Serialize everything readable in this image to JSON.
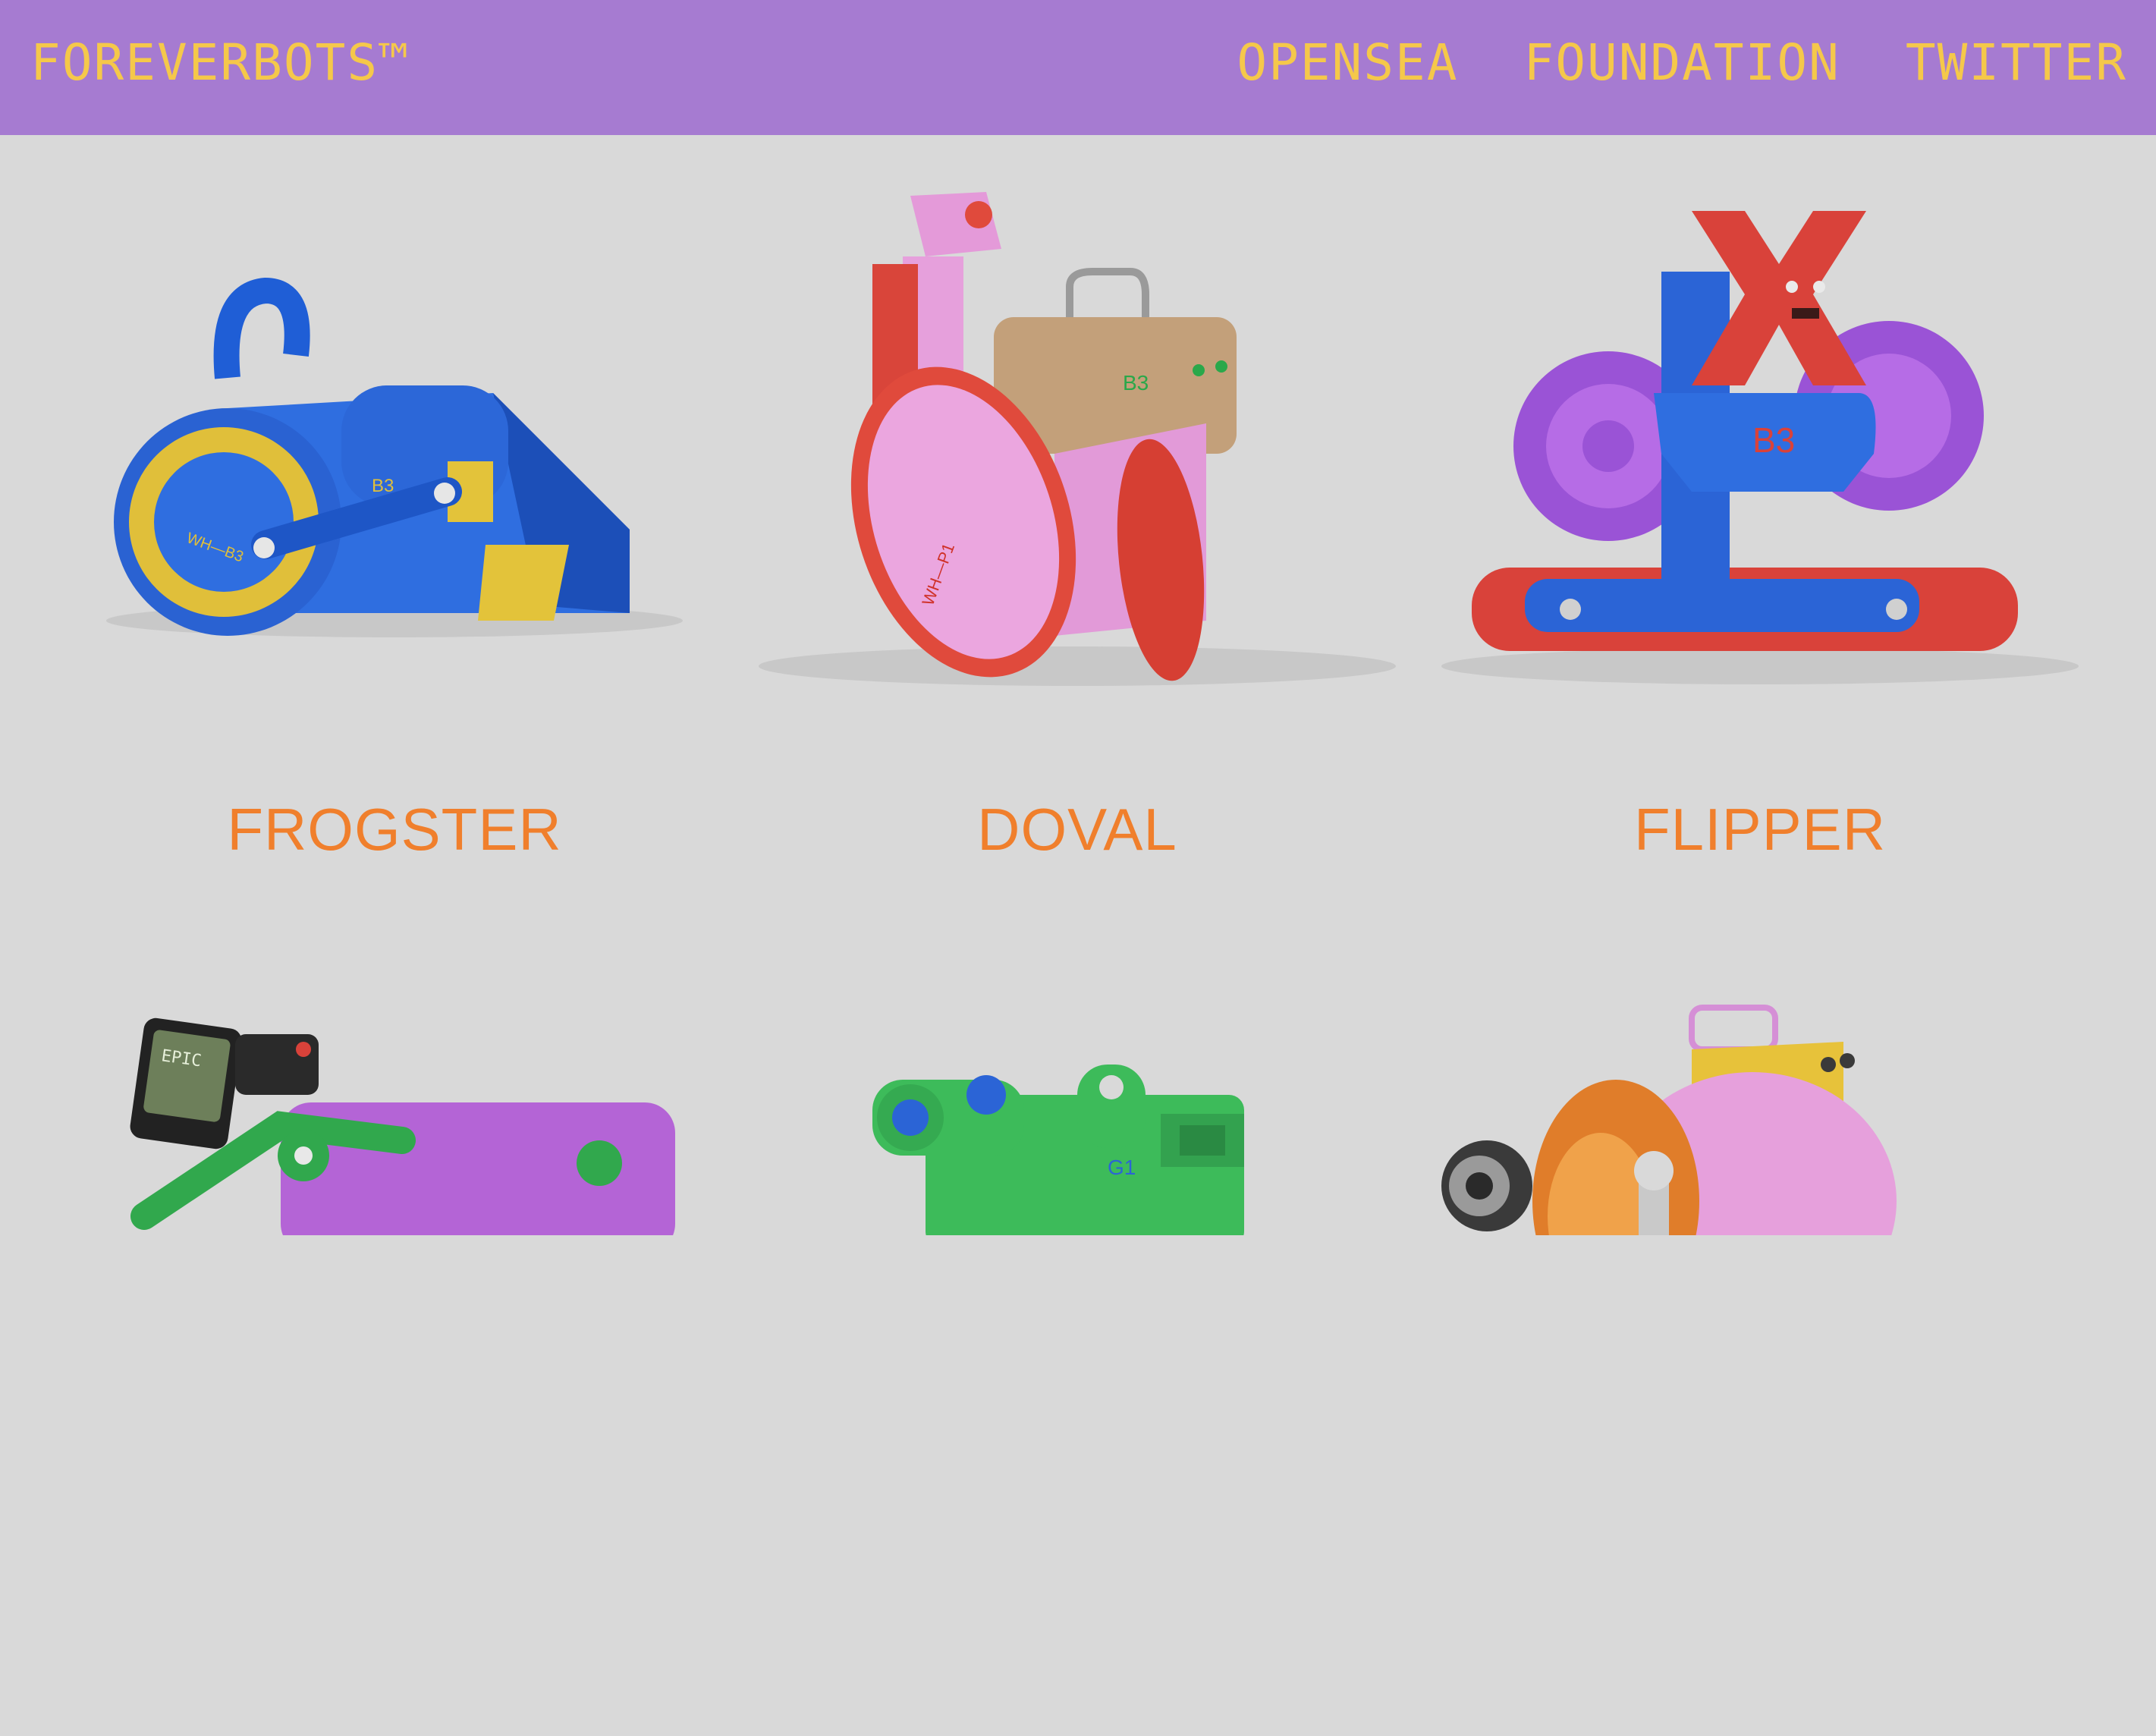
{
  "header": {
    "brand": "FOREVERBOTS™",
    "nav": [
      "OPENSEA",
      "FOUNDATION",
      "TWITTER"
    ]
  },
  "bots": [
    {
      "name": "FROGSTER",
      "label": "WH—B3",
      "mark": "B3"
    },
    {
      "name": "DOVAL",
      "label": "WH—P1",
      "mark": "B3"
    },
    {
      "name": "FLIPPER",
      "mark": "B3"
    },
    {
      "name": "",
      "screen_text": "EPIC"
    },
    {
      "name": "",
      "mark": "G1"
    },
    {
      "name": ""
    }
  ],
  "colors": {
    "header_bg": "#a67bd1",
    "nav_text": "#f5c84a",
    "page_bg": "#d9d9d9",
    "bot_name": "#f07f2c"
  }
}
